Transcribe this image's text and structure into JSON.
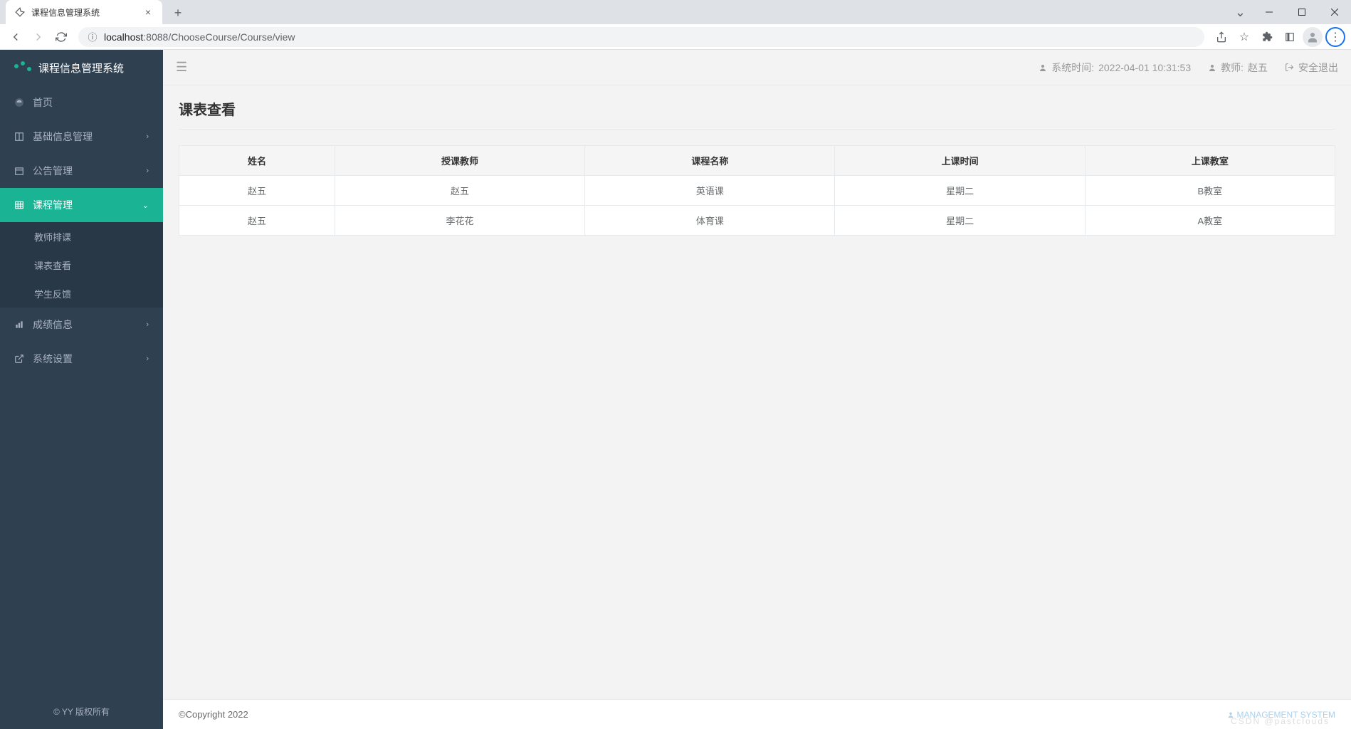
{
  "browser": {
    "tab_title": "课程信息管理系统",
    "url_host": "localhost",
    "url_port": ":8088",
    "url_path": "/ChooseCourse/Course/view"
  },
  "brand": {
    "title": "课程信息管理系统"
  },
  "sidebar": {
    "items": [
      {
        "label": "首页"
      },
      {
        "label": "基础信息管理"
      },
      {
        "label": "公告管理"
      },
      {
        "label": "课程管理"
      },
      {
        "label": "成绩信息"
      },
      {
        "label": "系统设置"
      }
    ],
    "sub_items": [
      {
        "label": "教师排课"
      },
      {
        "label": "课表查看"
      },
      {
        "label": "学生反馈"
      }
    ],
    "footer": "© YY 版权所有"
  },
  "topbar": {
    "system_time_label": "系统时间:",
    "system_time_value": "2022-04-01 10:31:53",
    "role_label": "教师:",
    "role_value": "赵五",
    "logout": "安全退出"
  },
  "page": {
    "title": "课表查看"
  },
  "table": {
    "headers": [
      "姓名",
      "授课教师",
      "课程名称",
      "上课时间",
      "上课教室"
    ],
    "rows": [
      [
        "赵五",
        "赵五",
        "英语课",
        "星期二",
        "B教室"
      ],
      [
        "赵五",
        "李花花",
        "体育课",
        "星期二",
        "A教室"
      ]
    ]
  },
  "footer": {
    "copyright": "©Copyright 2022",
    "right_label": "MANAGEMENT SYSTEM",
    "watermark": "CSDN @pastclouds"
  }
}
